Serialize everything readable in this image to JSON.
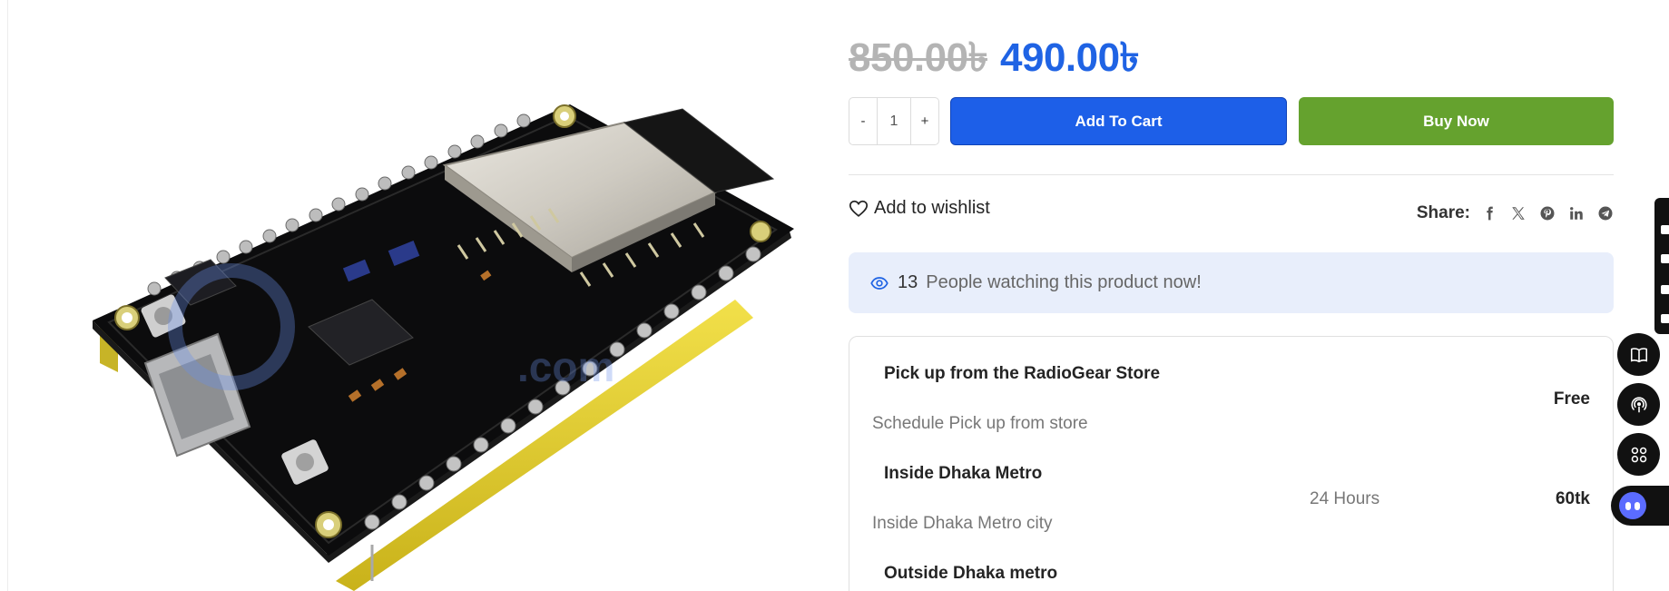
{
  "price": {
    "old": "850.00৳",
    "current": "490.00৳"
  },
  "quantity": {
    "minus": "-",
    "value": "1",
    "plus": "+"
  },
  "buttons": {
    "add_to_cart": "Add To Cart",
    "buy_now": "Buy Now"
  },
  "wishlist": {
    "label": "Add to wishlist",
    "icon": "heart-icon"
  },
  "share": {
    "label": "Share:",
    "networks": [
      "facebook",
      "x",
      "pinterest",
      "linkedin",
      "telegram"
    ]
  },
  "watching": {
    "count": "13",
    "text": "People watching this product now!"
  },
  "shipping": [
    {
      "title": "Pick up from the RadioGear Store",
      "description": "Schedule Pick up from store",
      "time": "",
      "price": "Free"
    },
    {
      "title": "Inside Dhaka Metro",
      "description": "Inside Dhaka Metro city",
      "time": "24 Hours",
      "price": "60tk"
    },
    {
      "title": "Outside Dhaka metro",
      "description": "",
      "time": "",
      "price": ""
    }
  ],
  "colors": {
    "accent_blue": "#1d5fe8",
    "price_blue": "#1f63e4",
    "buy_green": "#65a22e",
    "watching_bg": "#e8eefb"
  },
  "floating_icons": [
    "book-icon",
    "podcast-icon",
    "grid-icon",
    "chatbot-icon"
  ]
}
